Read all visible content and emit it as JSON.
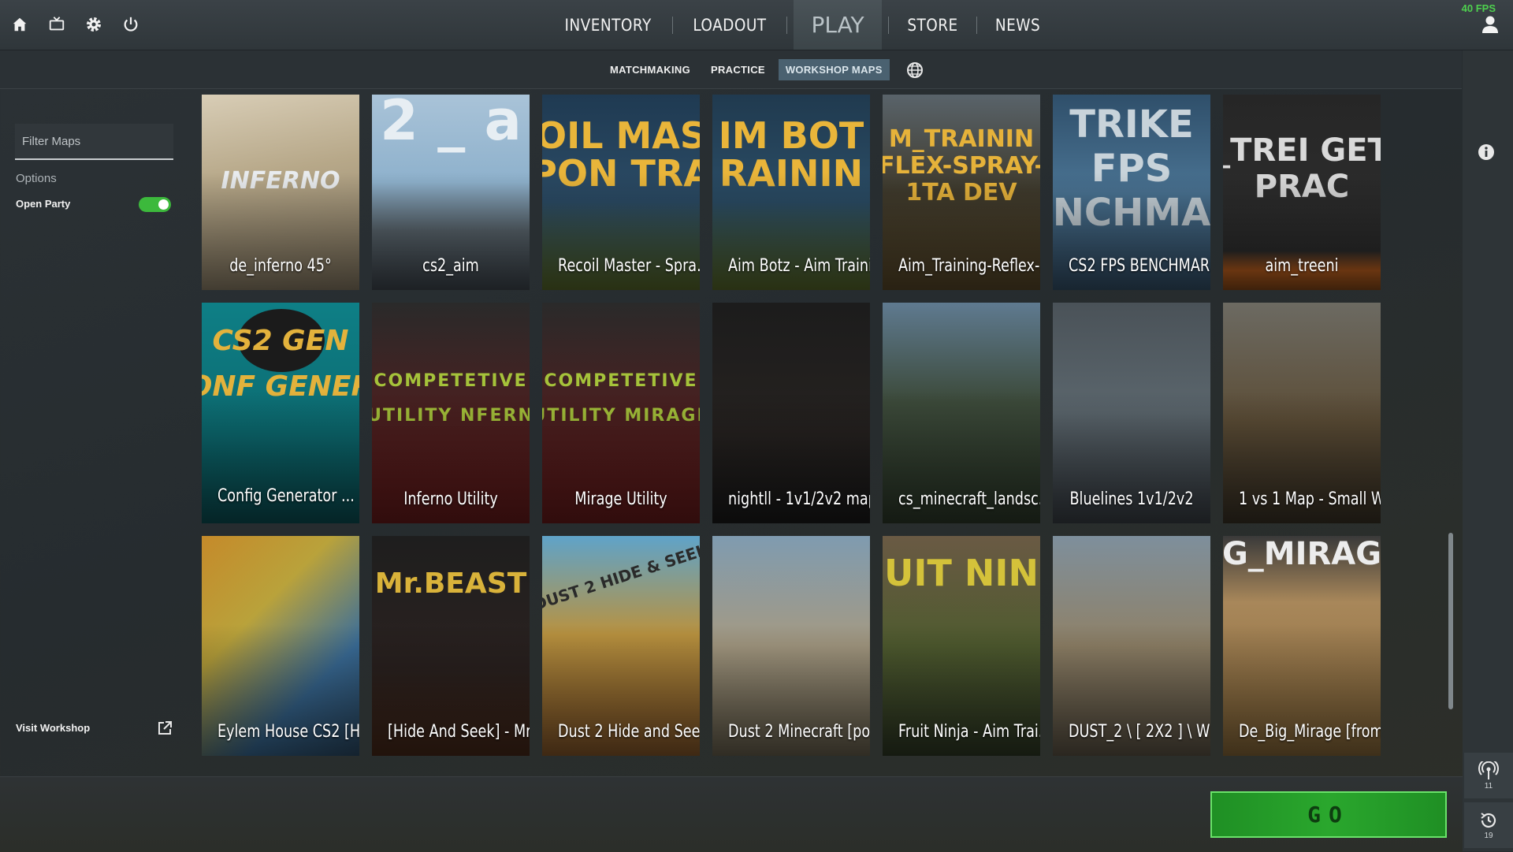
{
  "top_icons": [
    "home-icon",
    "tv-icon",
    "gear-icon",
    "power-icon"
  ],
  "main_nav": {
    "inventory": "INVENTORY",
    "loadout": "LOADOUT",
    "play": "PLAY",
    "store": "STORE",
    "news": "NEWS"
  },
  "fps": "40 FPS",
  "sub_nav": {
    "matchmaking": "MATCHMAKING",
    "practice": "PRACTICE",
    "workshop_maps": "WORKSHOP MAPS",
    "active": "WORKSHOP MAPS"
  },
  "sidebar": {
    "filter_placeholder": "Filter Maps",
    "options_label": "Options",
    "open_party_label": "Open Party",
    "open_party_on": true,
    "visit_workshop": "Visit Workshop"
  },
  "maps": [
    {
      "name": "de_inferno 45°",
      "art_text": "INFERNO"
    },
    {
      "name": "cs2_aim",
      "art_text": "2 _ a"
    },
    {
      "name": "Recoil Master - Spra...",
      "art_text": "OIL MAS PON TRA"
    },
    {
      "name": "Aim Botz - Aim Traini...",
      "art_text": "IM BOT RAININ"
    },
    {
      "name": "Aim_Training-Reflex-...",
      "art_text": "M_TRAININ FLEX-SPRAY-1TA DEV"
    },
    {
      "name": "CS2 FPS BENCHMAR...",
      "art_text": "TRIKE FPS NCHMA"
    },
    {
      "name": "aim_treeni",
      "art_text": "_TREI GET PRAC"
    },
    {
      "name": "Config Generator ...",
      "art_text": "CS2 GEN ONF GENER",
      "selected": true
    },
    {
      "name": "Inferno Utility",
      "art_text": "COMPETETIVE UTILITY NFERN"
    },
    {
      "name": "Mirage Utility",
      "art_text": "COMPETETIVE UTILITY MIRAGE"
    },
    {
      "name": "nightll - 1v1/2v2 map",
      "art_text": ""
    },
    {
      "name": "cs_minecraft_landsc...",
      "art_text": ""
    },
    {
      "name": "Bluelines 1v1/2v2",
      "art_text": ""
    },
    {
      "name": "1 vs 1 Map - Small W...",
      "art_text": ""
    },
    {
      "name": "Eylem House CS2 [H...",
      "art_text": ""
    },
    {
      "name": "[Hide And Seek] - Mr....",
      "art_text": "Mr.BEAST"
    },
    {
      "name": "Dust 2 Hide and Seek",
      "art_text": "DUST 2 HIDE & SEEK"
    },
    {
      "name": "Dust 2 Minecraft [port]",
      "art_text": ""
    },
    {
      "name": "Fruit Ninja - Aim Trai...",
      "art_text": "UIT NIN"
    },
    {
      "name": "DUST_2 \\ [ 2X2 ] \\ WI...",
      "art_text": ""
    },
    {
      "name": "De_Big_Mirage [from ...",
      "art_text": "G_MIRAG"
    }
  ],
  "rail": {
    "info_icon": "info-icon",
    "signal_count": "11",
    "history_count": "19"
  },
  "go_label": "GO",
  "colors": {
    "go_green": "#2aa72d",
    "toggle_green": "#3cb93c",
    "active_tab": "#4a6170",
    "fps_green": "#4ed04e"
  }
}
